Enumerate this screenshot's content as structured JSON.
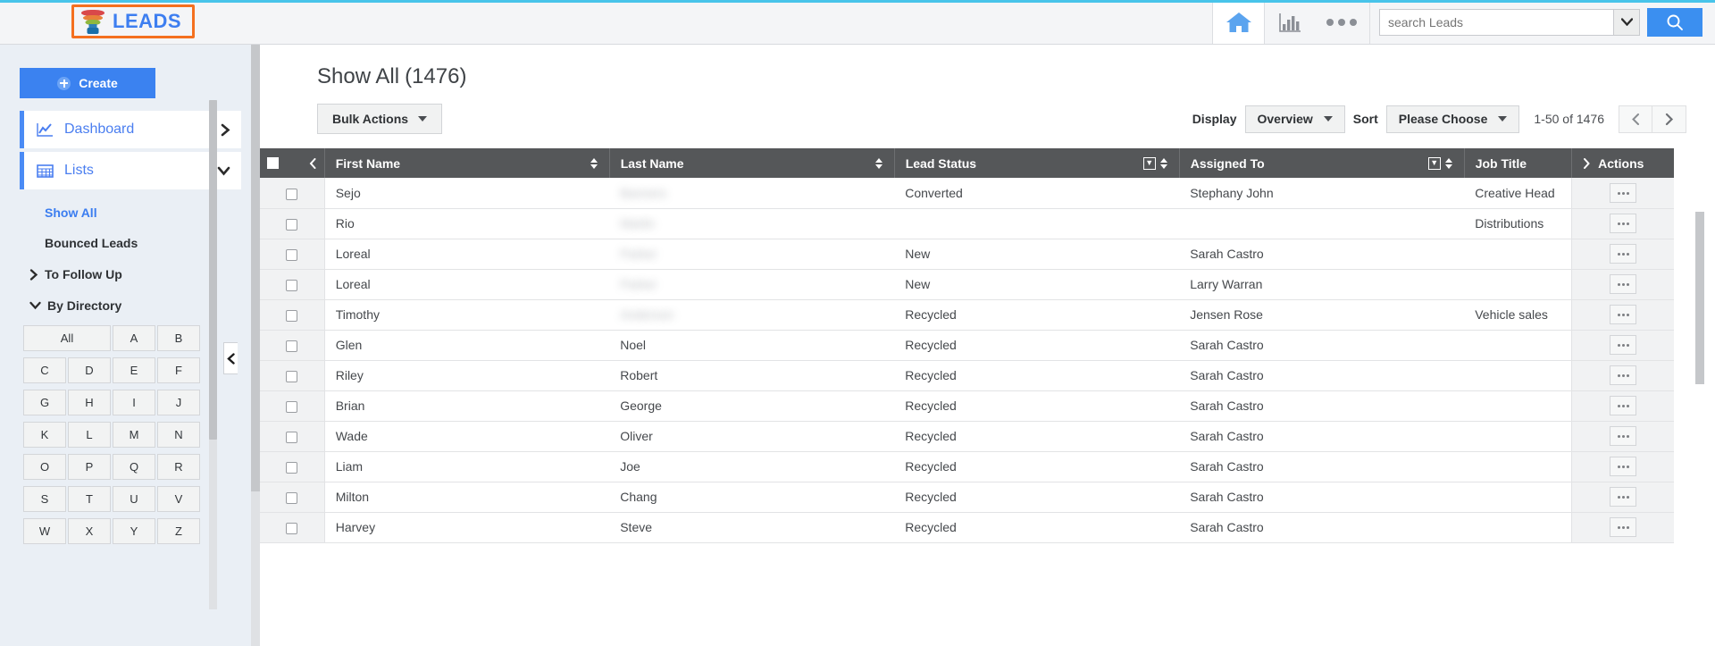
{
  "topbar": {
    "brand_label": "LEADS",
    "home_icon": "home-icon",
    "chart_icon": "bar-chart-icon",
    "more_icon": "ellipsis-icon",
    "search_placeholder": "search Leads",
    "search_value": "",
    "search_button_icon": "search-icon",
    "accent_color": "#48c4ea",
    "brand_color": "#3d7ef0",
    "brand_border_color": "#f4701f"
  },
  "sidebar": {
    "create_label": "Create",
    "nav": [
      {
        "label": "Dashboard",
        "icon": "line-chart-icon",
        "chevron": "chevron-right"
      },
      {
        "label": "Lists",
        "icon": "grid-icon",
        "chevron": "chevron-down"
      }
    ],
    "lists_children": [
      {
        "label": "Show All",
        "active": true
      },
      {
        "label": "Bounced Leads",
        "active": false
      }
    ],
    "trees": [
      {
        "label": "To Follow Up",
        "expanded": false,
        "chevron": "chevron-right"
      },
      {
        "label": "By Directory",
        "expanded": true,
        "chevron": "chevron-down"
      }
    ],
    "alphabet": [
      "All",
      "A",
      "B",
      "C",
      "D",
      "E",
      "F",
      "G",
      "H",
      "I",
      "J",
      "K",
      "L",
      "M",
      "N",
      "O",
      "P",
      "Q",
      "R",
      "S",
      "T",
      "U",
      "V",
      "W",
      "X",
      "Y",
      "Z"
    ],
    "collapse_icon": "chevron-left-icon"
  },
  "main": {
    "title": "Show All",
    "count": "(1476)",
    "bulk_actions_label": "Bulk Actions",
    "display_label": "Display",
    "display_value": "Overview",
    "sort_label": "Sort",
    "sort_value": "Please Choose",
    "range_label": "1-50 of 1476",
    "prev_icon": "chevron-left-icon",
    "next_icon": "chevron-right-icon"
  },
  "table": {
    "columns": [
      {
        "key": "first_name",
        "label": "First Name",
        "sortable": true,
        "filterable": false
      },
      {
        "key": "last_name",
        "label": "Last Name",
        "sortable": true,
        "filterable": false
      },
      {
        "key": "lead_status",
        "label": "Lead Status",
        "sortable": true,
        "filterable": true
      },
      {
        "key": "assigned_to",
        "label": "Assigned To",
        "sortable": true,
        "filterable": true
      },
      {
        "key": "job_title",
        "label": "Job Title",
        "sortable": false,
        "filterable": false
      },
      {
        "key": "actions",
        "label": "Actions",
        "sortable": false,
        "filterable": false
      }
    ],
    "actions_header_chevron": "chevron-right",
    "header_collapse_icon": "chevron-left-icon",
    "rows": [
      {
        "first_name": "Sejo",
        "last_name": "Banners",
        "last_name_redacted": true,
        "lead_status": "Converted",
        "assigned_to": "Stephany John",
        "job_title": "Creative Head"
      },
      {
        "first_name": "Rio",
        "last_name": "Martin",
        "last_name_redacted": true,
        "lead_status": "",
        "assigned_to": "",
        "job_title": "Distributions"
      },
      {
        "first_name": "Loreal",
        "last_name": "Parker",
        "last_name_redacted": true,
        "lead_status": "New",
        "assigned_to": "Sarah Castro",
        "job_title": ""
      },
      {
        "first_name": "Loreal",
        "last_name": "Parker",
        "last_name_redacted": true,
        "lead_status": "New",
        "assigned_to": "Larry Warran",
        "job_title": ""
      },
      {
        "first_name": "Timothy",
        "last_name": "Anderson",
        "last_name_redacted": true,
        "lead_status": "Recycled",
        "assigned_to": "Jensen Rose",
        "job_title": "Vehicle sales"
      },
      {
        "first_name": "Glen",
        "last_name": "Noel",
        "last_name_redacted": false,
        "lead_status": "Recycled",
        "assigned_to": "Sarah Castro",
        "job_title": ""
      },
      {
        "first_name": "Riley",
        "last_name": "Robert",
        "last_name_redacted": false,
        "lead_status": "Recycled",
        "assigned_to": "Sarah Castro",
        "job_title": ""
      },
      {
        "first_name": "Brian",
        "last_name": "George",
        "last_name_redacted": false,
        "lead_status": "Recycled",
        "assigned_to": "Sarah Castro",
        "job_title": ""
      },
      {
        "first_name": "Wade",
        "last_name": "Oliver",
        "last_name_redacted": false,
        "lead_status": "Recycled",
        "assigned_to": "Sarah Castro",
        "job_title": ""
      },
      {
        "first_name": "Liam",
        "last_name": "Joe",
        "last_name_redacted": false,
        "lead_status": "Recycled",
        "assigned_to": "Sarah Castro",
        "job_title": ""
      },
      {
        "first_name": "Milton",
        "last_name": "Chang",
        "last_name_redacted": false,
        "lead_status": "Recycled",
        "assigned_to": "Sarah Castro",
        "job_title": ""
      },
      {
        "first_name": "Harvey",
        "last_name": "Steve",
        "last_name_redacted": false,
        "lead_status": "Recycled",
        "assigned_to": "Sarah Castro",
        "job_title": ""
      }
    ],
    "row_action_icon": "ellipsis-icon",
    "header_bg": "#555759"
  }
}
